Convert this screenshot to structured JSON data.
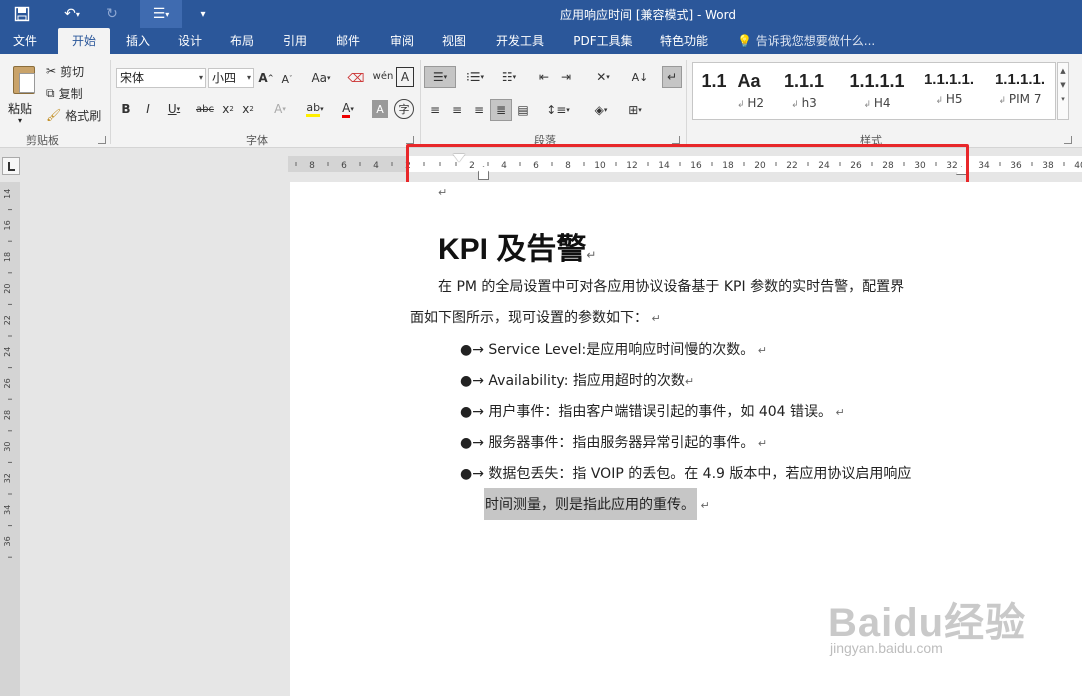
{
  "window": {
    "title": "应用响应时间 [兼容模式] - Word"
  },
  "tabs": [
    "文件",
    "开始",
    "插入",
    "设计",
    "布局",
    "引用",
    "邮件",
    "审阅",
    "视图",
    "开发工具",
    "PDF工具集",
    "特色功能"
  ],
  "tell_me": "告诉我您想要做什么...",
  "clipboard": {
    "paste": "粘贴",
    "cut": "剪切",
    "copy": "复制",
    "format_painter": "格式刷",
    "group": "剪贴板"
  },
  "font": {
    "name": "宋体",
    "size": "小四",
    "group": "字体"
  },
  "paragraph": {
    "group": "段落"
  },
  "styles": {
    "group": "样式",
    "items": [
      {
        "sample": "1.1",
        "name": ""
      },
      {
        "sample": "Aa",
        "name": "H2"
      },
      {
        "sample": "1.1.1",
        "name": "h3"
      },
      {
        "sample": "1.1.1.1",
        "name": "H4"
      },
      {
        "sample": "1.1.1.1.",
        "name": "H5"
      },
      {
        "sample": "1.1.1.1.",
        "name": "PIM 7"
      }
    ]
  },
  "document": {
    "title": "KPI 及告警",
    "intro_line1": "在 PM 的全局设置中可对各应用协议设备基于 KPI 参数的实时告警，配置界",
    "intro_line2": "面如下图所示，现可设置的参数如下：",
    "bullets": [
      "Service Level:是应用响应时间慢的次数。",
      "Availability: 指应用超时的次数",
      "用户事件：指由客户端错误引起的事件，如 404 错误。",
      "服务器事件：指由服务器异常引起的事件。",
      "数据包丢失：指 VOIP 的丢包。在 4.9 版本中，若应用协议启用响应"
    ],
    "bullet_continuation": "时间测量，则是指此应用的重传。"
  },
  "watermark": {
    "brand": "Baidu经验",
    "url": "jingyan.baidu.com"
  },
  "colors": {
    "titlebar": "#2b579a",
    "highlight": "#e8272a"
  }
}
